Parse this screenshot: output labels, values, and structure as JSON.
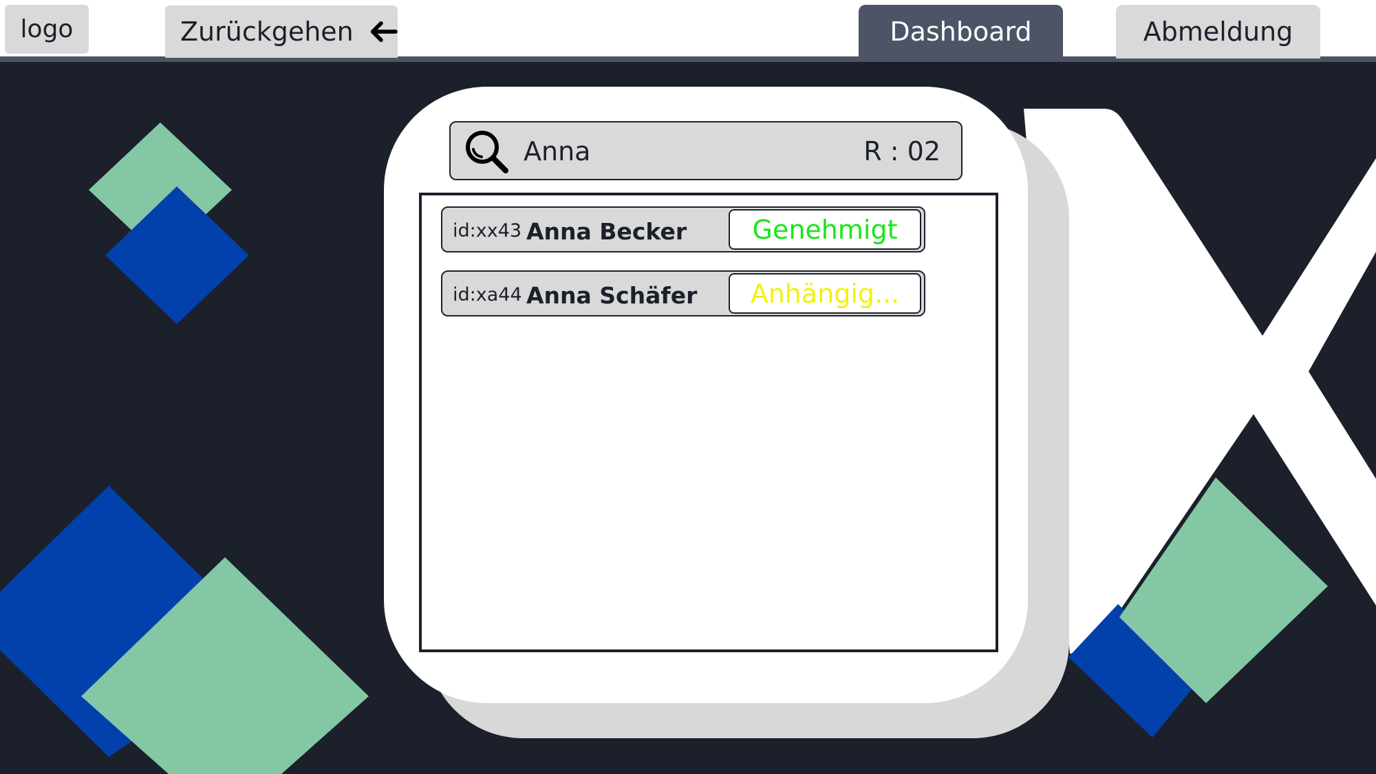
{
  "header": {
    "logo_label": "logo",
    "back_label": "Zurückgehen",
    "dashboard_label": "Dashboard",
    "logout_label": "Abmeldung"
  },
  "search": {
    "query": "Anna",
    "result_count": "R : 02"
  },
  "results": [
    {
      "id": "id:xx43",
      "name": "Anna Becker",
      "status": "Genehmigt",
      "status_color": "#19e619"
    },
    {
      "id": "id:xa44",
      "name": "Anna Schäfer",
      "status": "Anhängig...",
      "status_color": "#f2f20d"
    }
  ],
  "colors": {
    "background": "#1b202b",
    "accent_dark": "#4c5466",
    "button_gray": "#d9d9d9",
    "deco_green": "#84c7a5",
    "deco_blue": "#0241ac"
  },
  "icons": {
    "search": "search-icon",
    "back": "arrow-left-icon"
  }
}
